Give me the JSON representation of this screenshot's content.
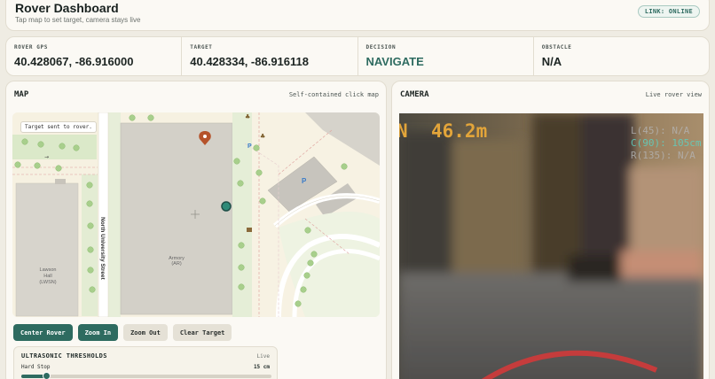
{
  "header": {
    "title": "Rover Dashboard",
    "subtitle": "Tap map to set target, camera stays live",
    "link_badge": "LINK: ONLINE"
  },
  "stats": [
    {
      "label": "ROVER GPS",
      "value": "40.428067, -86.916000"
    },
    {
      "label": "TARGET",
      "value": "40.428334, -86.916118"
    },
    {
      "label": "DECISION",
      "value": "NAVIGATE"
    },
    {
      "label": "OBSTACLE",
      "value": "N/A"
    }
  ],
  "map": {
    "title": "MAP",
    "hint": "Self-contained click map",
    "toast": "Target sent to rover.",
    "labels": {
      "street": "North University Street",
      "armory": "Armory",
      "armory_code": "(AR)",
      "lawson_1": "Lawson",
      "lawson_2": "Hall",
      "lawson_code": "(LWSN)",
      "parking": "P"
    },
    "buttons": {
      "center": "Center Rover",
      "zoom_in": "Zoom In",
      "zoom_out": "Zoom Out",
      "clear": "Clear Target"
    },
    "thresholds": {
      "title": "ULTRASONIC THRESHOLDS",
      "live": "Live",
      "hard_stop_label": "Hard Stop",
      "hard_stop_value": "15 cm",
      "hard_stop_fraction": 0.1
    }
  },
  "camera": {
    "title": "CAMERA",
    "hint": "Live rover view",
    "hud": {
      "heading": "N",
      "distance": "46.2m",
      "left": "L(45): N/A",
      "center": "C(90): 105cm",
      "right": "R(135): N/A"
    }
  },
  "colors": {
    "accent": "#2e6b60",
    "hud_orange": "#e3a53a",
    "hud_teal": "#5fd0c0",
    "target_marker": "#b5532b"
  }
}
